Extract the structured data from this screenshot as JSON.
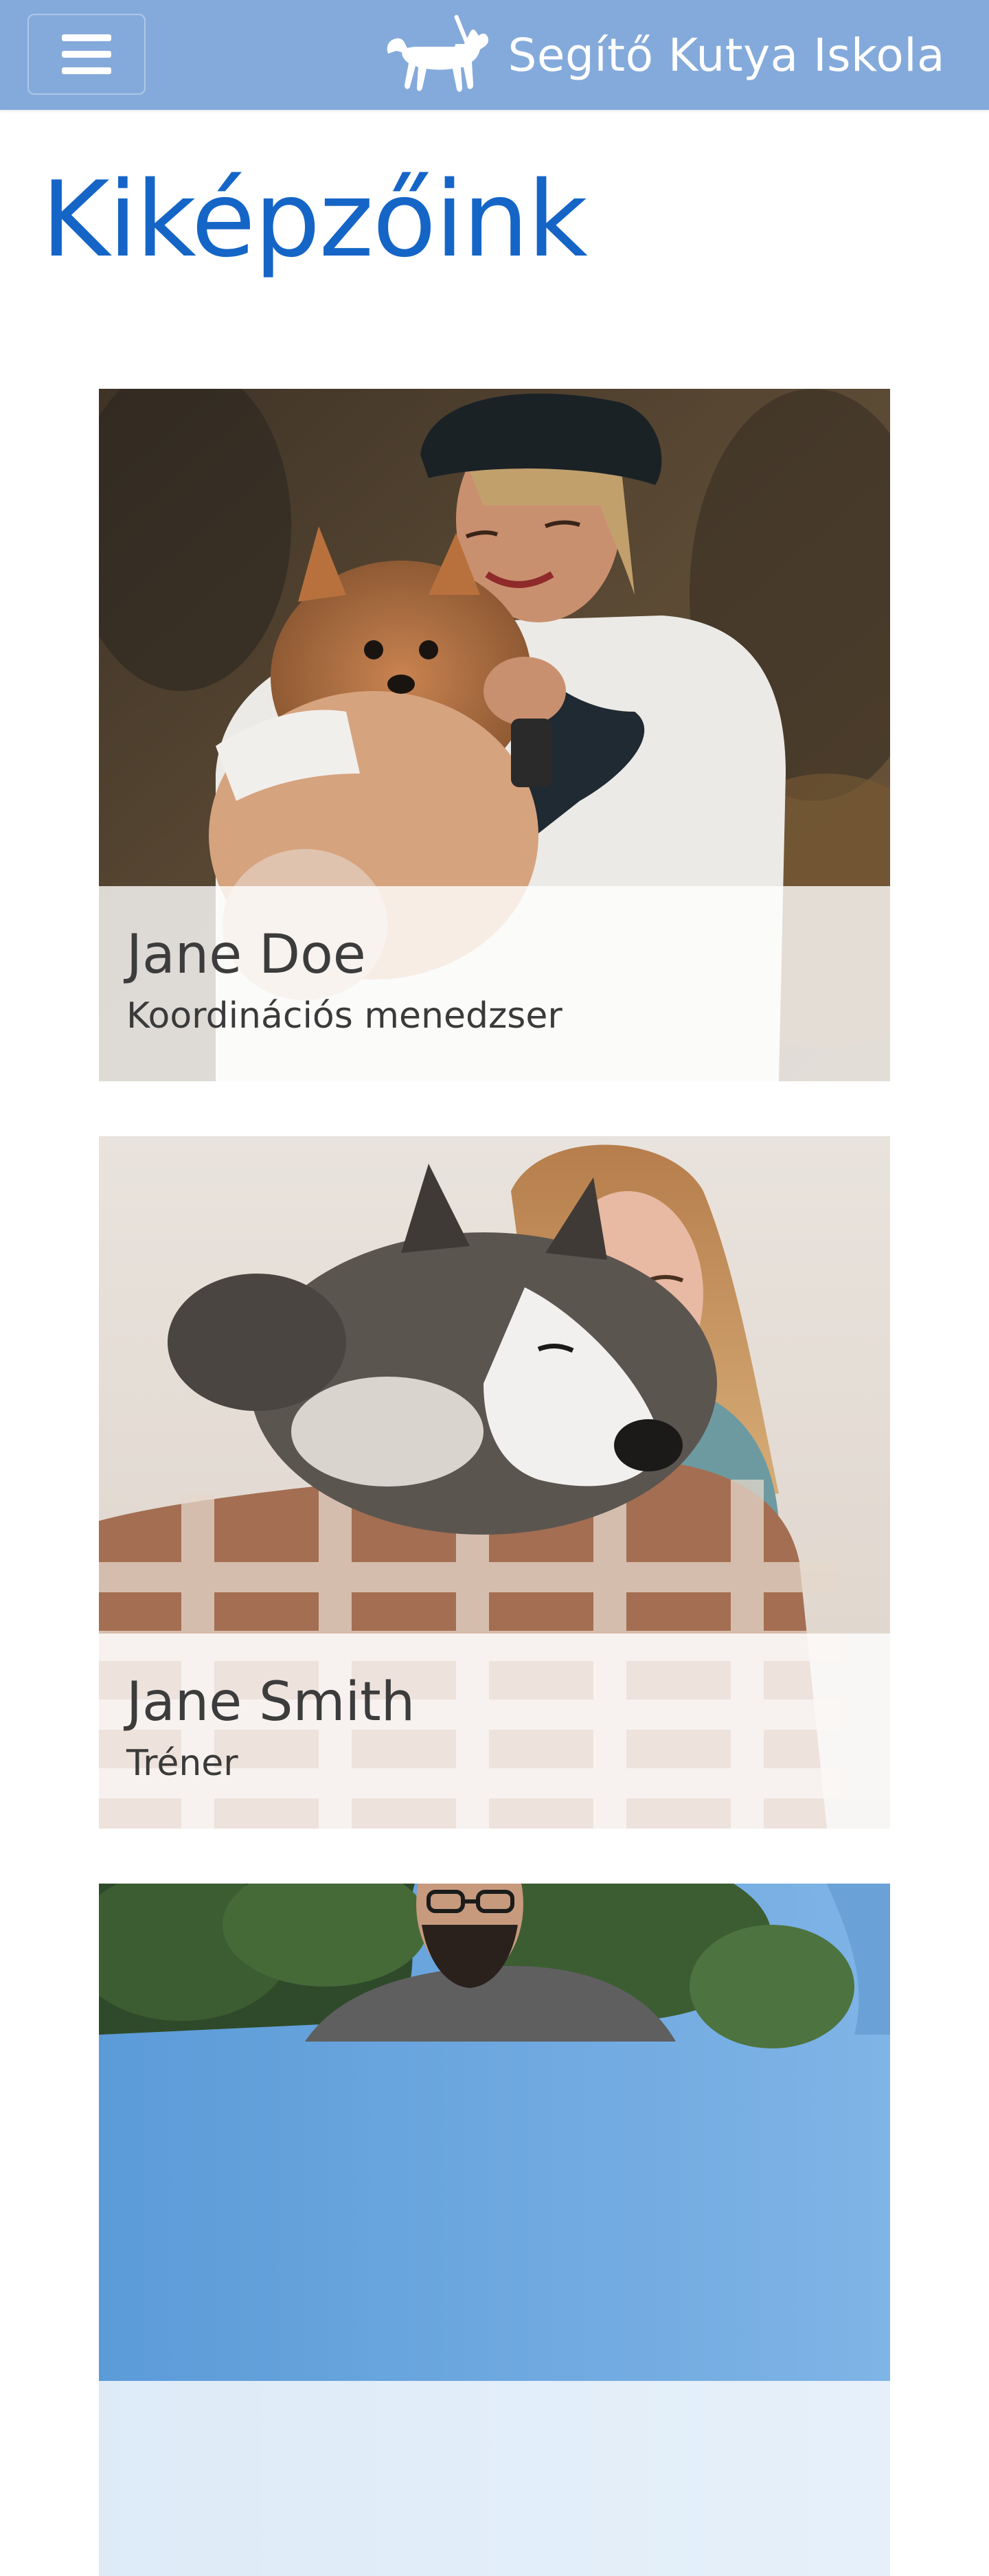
{
  "navbar": {
    "menu_icon": "hamburger-icon",
    "logo_icon": "guide-dog-icon",
    "brand_text": "Segítő Kutya Iskola",
    "background_color": "#84aadb"
  },
  "page": {
    "title": "Kiképzőink",
    "title_color": "#1565c7"
  },
  "trainers": [
    {
      "name": "Jane Doe",
      "role": "Koordinációs menedzser"
    },
    {
      "name": "Jane Smith",
      "role": "Tréner"
    },
    {
      "name": "",
      "role": ""
    }
  ]
}
